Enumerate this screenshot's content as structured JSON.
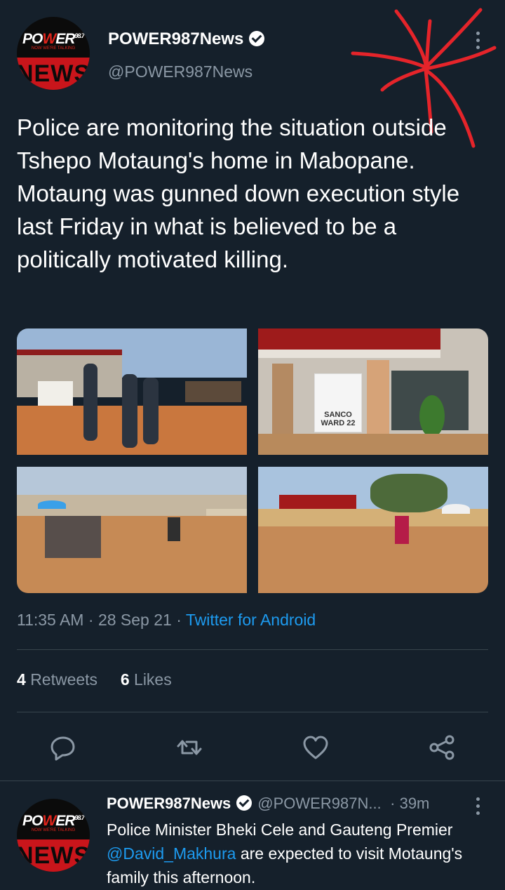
{
  "tweet": {
    "logo": {
      "brand_a": "PO",
      "brand_o": "W",
      "brand_b": "ER",
      "brand_sup": "98.7",
      "tagline": "NOW WE'RE TALKING",
      "band": "NEWS"
    },
    "display_name": "POWER987News",
    "handle": "@POWER987News",
    "text": "Police are monitoring the situation outside Tshepo Motaung's home in Mabopane. Motaung was gunned down execution style last Friday in what is believed to be a politically motivated killing.",
    "time": "11:35 AM",
    "date": "28 Sep 21",
    "separator": "·",
    "source": "Twitter for Android",
    "retweets_count": "4",
    "retweets_label": "Retweets",
    "likes_count": "6",
    "likes_label": "Likes",
    "banner_text": "SANCO WARD 22"
  },
  "actions": {
    "reply": "reply-icon",
    "retweet": "retweet-icon",
    "like": "heart-icon",
    "share": "share-icon"
  },
  "reply_tweet": {
    "display_name": "POWER987News",
    "handle": "@POWER987N...",
    "time": "· 39m",
    "mention": "@David_Makhura",
    "text_before": "Police Minister Bheki Cele and Gauteng Premier",
    "text_after": "are expected to visit Motaung's family this afternoon."
  },
  "colors": {
    "background": "#15202b",
    "accent": "#1d9bf0",
    "muted": "#8b98a5",
    "annotation": "#e5242a"
  }
}
